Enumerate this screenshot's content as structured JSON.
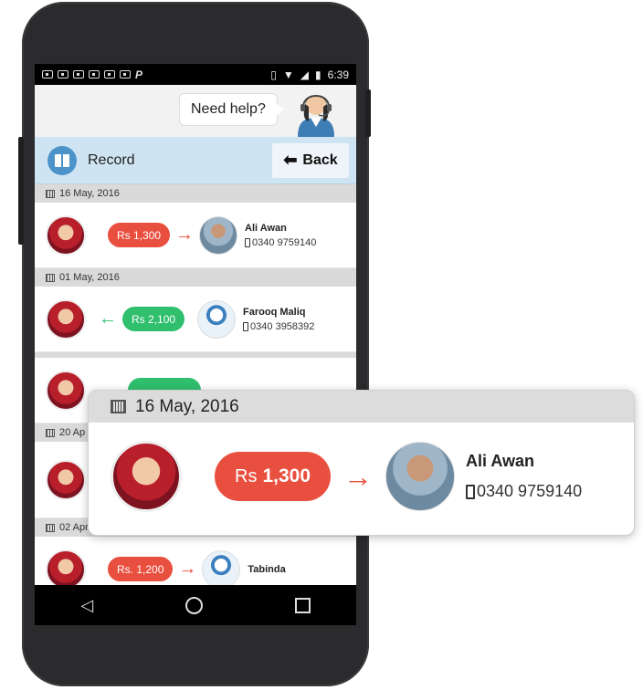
{
  "status_bar": {
    "time": "6:39"
  },
  "help": {
    "label": "Need help?"
  },
  "header": {
    "title": "Record",
    "back_label": "Back"
  },
  "records": [
    {
      "date": "16 May, 2016",
      "direction": "out",
      "currency": "Rs",
      "amount": "1,300",
      "name": "Ali Awan",
      "phone": "0340 9759140"
    },
    {
      "date": "01 May, 2016",
      "direction": "in",
      "currency": "Rs",
      "amount": "2,100",
      "name": "Farooq Maliq",
      "phone": "0340 3958392"
    },
    {
      "date": "",
      "direction": "in",
      "currency": "",
      "amount": "",
      "name": "",
      "phone": ""
    },
    {
      "date": "20 Ap",
      "direction": "",
      "currency": "",
      "amount": "",
      "name": "",
      "phone": ""
    },
    {
      "date": "02 Apr",
      "direction": "out",
      "currency": "Rs.",
      "amount": "1,200",
      "name": "Tabinda",
      "phone": ""
    }
  ],
  "zoom": {
    "date": "16 May, 2016",
    "currency": "Rs",
    "amount": "1,300",
    "name": "Ali Awan",
    "phone": "0340 9759140"
  },
  "colors": {
    "out": "#e94f3f",
    "in": "#2fbf6d",
    "header_bg": "#cfe4f2"
  }
}
